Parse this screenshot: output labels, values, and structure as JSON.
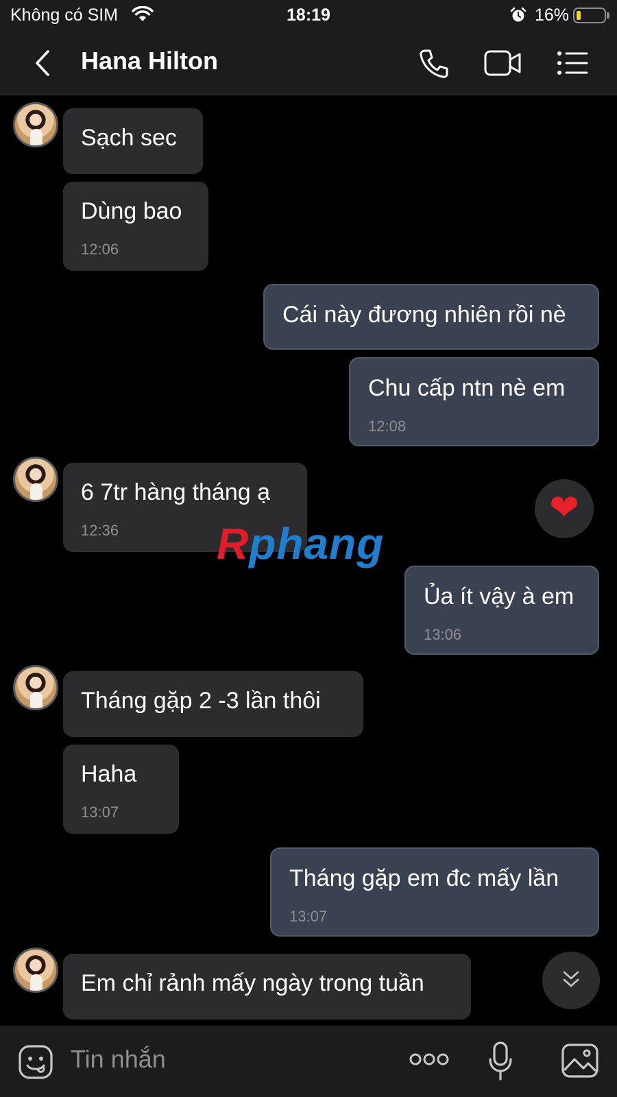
{
  "status_bar": {
    "carrier": "Không có SIM",
    "time": "18:19",
    "battery_percent": "16%",
    "battery_level": 0.16,
    "battery_color": "#ffd60a",
    "icons": [
      "wifi-icon",
      "alarm-icon",
      "battery-icon"
    ]
  },
  "header": {
    "title": "Hana Hilton",
    "icons": [
      "back-icon",
      "phone-call-icon",
      "video-call-icon",
      "menu-list-icon"
    ]
  },
  "messages": [
    {
      "direction": "in",
      "text": "Sạch sec",
      "time": ""
    },
    {
      "direction": "in",
      "text": "Dùng bao",
      "time": "12:06"
    },
    {
      "direction": "out",
      "text": "Cái này đương nhiên rồi nè",
      "time": ""
    },
    {
      "direction": "out",
      "text": "Chu cấp ntn nè em",
      "time": "12:08"
    },
    {
      "direction": "in",
      "text": "6 7tr hàng tháng ạ",
      "time": "12:36",
      "reaction": "heart"
    },
    {
      "direction": "out",
      "text": "Ủa ít vậy à em",
      "time": "13:06"
    },
    {
      "direction": "in",
      "text": "Tháng gặp 2 -3 lần thôi",
      "time": ""
    },
    {
      "direction": "in",
      "text": "Haha",
      "time": "13:07"
    },
    {
      "direction": "out",
      "text": "Tháng gặp em đc mấy lần",
      "time": "13:07"
    },
    {
      "direction": "in",
      "text": "Em chỉ rảnh mấy ngày trong tuần",
      "time": ""
    }
  ],
  "reaction": {
    "glyph": "❤",
    "name": "heart-reaction-icon"
  },
  "watermark": {
    "part1": "R",
    "part2": "phang"
  },
  "composer": {
    "placeholder": "Tin nhắn",
    "icons": [
      "sticker-icon",
      "more-dots-icon",
      "microphone-icon",
      "image-icon"
    ]
  },
  "colors": {
    "background": "#000000",
    "incoming_bubble": "#2c2c2e",
    "outgoing_bubble": "#3a4150",
    "timestamp": "#8e8e93"
  }
}
